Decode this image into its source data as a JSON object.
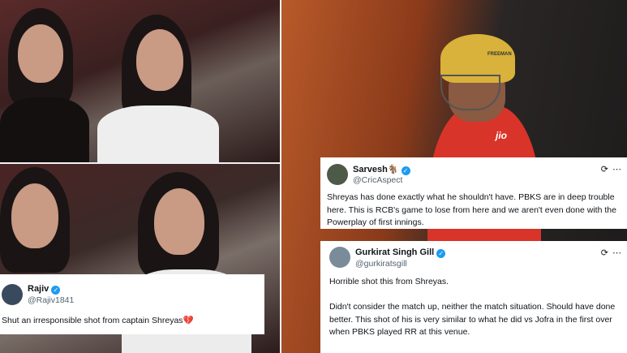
{
  "tweets": [
    {
      "name": "Sarvesh",
      "name_emoji": "🐐",
      "handle": "@CricAspect",
      "text": "Shreyas has done exactly what he shouldn't have. PBKS are in deep trouble here. This is RCB's game to lose from here and we aren't even done with the Powerplay of first innings.",
      "icons": "⟳ ⋯"
    },
    {
      "name": "Gurkirat Singh Gill",
      "handle": "@gurkiratsgill",
      "text_p1": "Horrible shot this from Shreyas.",
      "text_p2": "Didn't consider the match up, neither the match situation. Should have done better. This shot of his is very similar to what he did vs Jofra in the first over when PBKS played RR at this venue.",
      "icons": "⟳ ⋯"
    },
    {
      "name": "Rajiv",
      "handle": "@Rajiv1841",
      "text": "Shut an irresponsible shot from captain Shreyas",
      "text_emoji": "💔"
    }
  ],
  "helmet_text": "FREEMAN",
  "jersey_text": "jio",
  "colors": {
    "verified": "#1d9bf0",
    "handle": "#536471",
    "jersey": "#d8342a",
    "helmet": "#d8b23a"
  }
}
